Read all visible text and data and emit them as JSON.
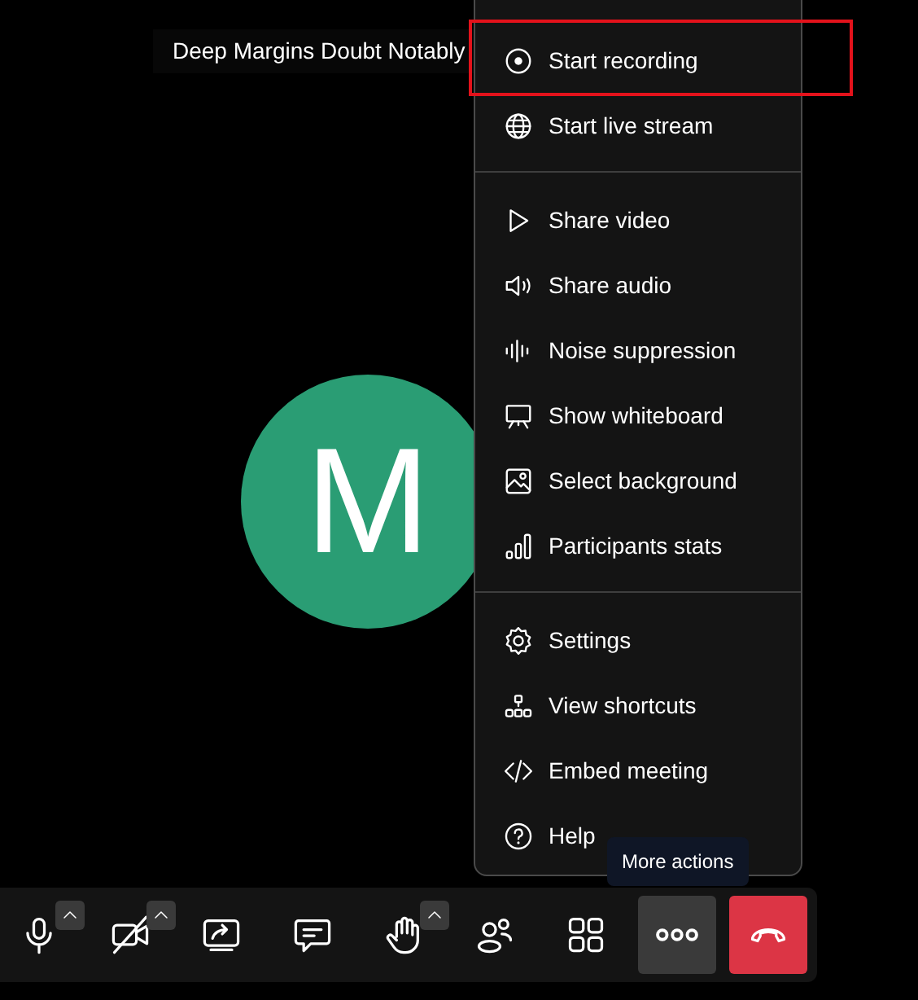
{
  "participant": {
    "name": "Deep Margins Doubt Notably",
    "initial": "M",
    "color": "#2a9d74"
  },
  "menu": {
    "groups": [
      [
        {
          "label": "Start recording",
          "outlined": true
        },
        {
          "label": "Start live stream",
          "outlined": false
        }
      ],
      [
        {
          "label": "Share video",
          "outlined": false
        },
        {
          "label": "Share audio",
          "outlined": false
        },
        {
          "label": "Noise suppression",
          "outlined": false
        },
        {
          "label": "Show whiteboard",
          "outlined": false
        },
        {
          "label": "Select background",
          "outlined": false
        },
        {
          "label": "Participants stats",
          "outlined": false
        }
      ],
      [
        {
          "label": "Settings",
          "outlined": false
        },
        {
          "label": "View shortcuts",
          "outlined": false
        },
        {
          "label": "Embed meeting",
          "outlined": false
        },
        {
          "label": "Help",
          "outlined": false
        }
      ]
    ]
  },
  "tooltip": "More actions",
  "toolbar": [
    {
      "kind": "mic",
      "caret": true,
      "active": false
    },
    {
      "kind": "camera-off",
      "caret": true,
      "active": false
    },
    {
      "kind": "share",
      "caret": false,
      "active": false
    },
    {
      "kind": "chat",
      "caret": false,
      "active": false
    },
    {
      "kind": "hand",
      "caret": true,
      "active": false
    },
    {
      "kind": "people",
      "caret": false,
      "active": false
    },
    {
      "kind": "grid",
      "caret": false,
      "active": false
    },
    {
      "kind": "more",
      "caret": false,
      "active": true
    },
    {
      "kind": "hangup",
      "caret": false,
      "active": false
    }
  ]
}
